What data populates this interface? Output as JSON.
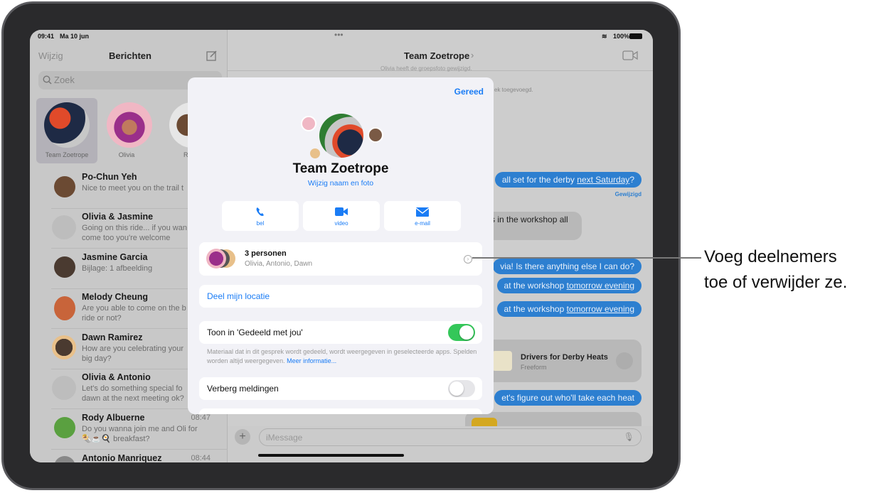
{
  "status_bar": {
    "time": "09:41",
    "date": "Ma 10 jun",
    "battery": "100%"
  },
  "sidebar": {
    "edit": "Wijzig",
    "title": "Berichten",
    "search_placeholder": "Zoek",
    "pinned": [
      {
        "label": "Team Zoetrope"
      },
      {
        "label": "Olivia"
      },
      {
        "label": "R"
      }
    ],
    "conversations": [
      {
        "name": "Po-Chun Yeh",
        "preview": "Nice to meet you on the trail t",
        "time": ""
      },
      {
        "name": "Olivia & Jasmine",
        "preview": "Going on this ride... if you wan",
        "preview2": "come too you're welcome",
        "time": ""
      },
      {
        "name": "Jasmine Garcia",
        "preview": "Bijlage: 1 afbeelding",
        "time": ""
      },
      {
        "name": "Melody Cheung",
        "preview": "Are you able to come on the b",
        "preview2": "ride or not?",
        "time": ""
      },
      {
        "name": "Dawn Ramirez",
        "preview": "How are you celebrating your",
        "preview2": "big day?",
        "time": ""
      },
      {
        "name": "Olivia & Antonio",
        "preview": "Let's do something special fo",
        "preview2": "dawn at the next meeting ok?",
        "time": ""
      },
      {
        "name": "Rody Albuerne",
        "preview": "Do you wanna join me and Oli for",
        "preview2": "🌯☕🍳 breakfast?",
        "time": "08:47"
      },
      {
        "name": "Antonio Manriquez",
        "preview": "",
        "time": "08:44"
      }
    ]
  },
  "chat": {
    "title": "Team Zoetrope",
    "faint1": "Olivia heeft de groepsfoto gewijzigd.",
    "faint2": "ek toegevoegd.",
    "messages": [
      {
        "text": "all set for the derby ",
        "link": "next Saturday",
        "tail": "?",
        "edited": "Gewijzigd"
      },
      {
        "text": "s in the workshop all"
      },
      {
        "text": "via! Is there anything else I can do?"
      },
      {
        "text": "at the workshop ",
        "link": "tomorrow evening"
      },
      {
        "text": "at the workshop ",
        "link": "tomorrow evening"
      },
      {
        "text": "et's figure out who'll take each heat"
      }
    ],
    "freeform": {
      "title": "Drivers for Derby Heats",
      "subtitle": "Freeform"
    },
    "input_placeholder": "iMessage"
  },
  "modal": {
    "done": "Gereed",
    "group_name": "Team Zoetrope",
    "edit_link": "Wijzig naam en foto",
    "actions": [
      {
        "label": "bel",
        "icon": "phone-icon"
      },
      {
        "label": "video",
        "icon": "video-icon"
      },
      {
        "label": "e-mail",
        "icon": "mail-icon"
      }
    ],
    "members_title": "3 personen",
    "members_names": "Olivia, Antonio, Dawn",
    "share_location": "Deel mijn locatie",
    "shared_with_you_label": "Toon in 'Gedeeld met jou'",
    "shared_with_you_on": true,
    "footnote": "Materiaal dat in dit gesprek wordt gedeeld, wordt weergegeven in geselecteerde apps. Spelden worden altijd weergegeven. ",
    "more_info": "Meer informatie...",
    "hide_alerts_label": "Verberg meldingen",
    "hide_alerts_on": false
  },
  "callout": {
    "line1": "Voeg deelnemers",
    "line2": "toe of verwijder ze."
  },
  "colors": {
    "accent": "#1a7cf5",
    "toggle_on": "#34c759",
    "bubble": "#2d7fd0"
  }
}
